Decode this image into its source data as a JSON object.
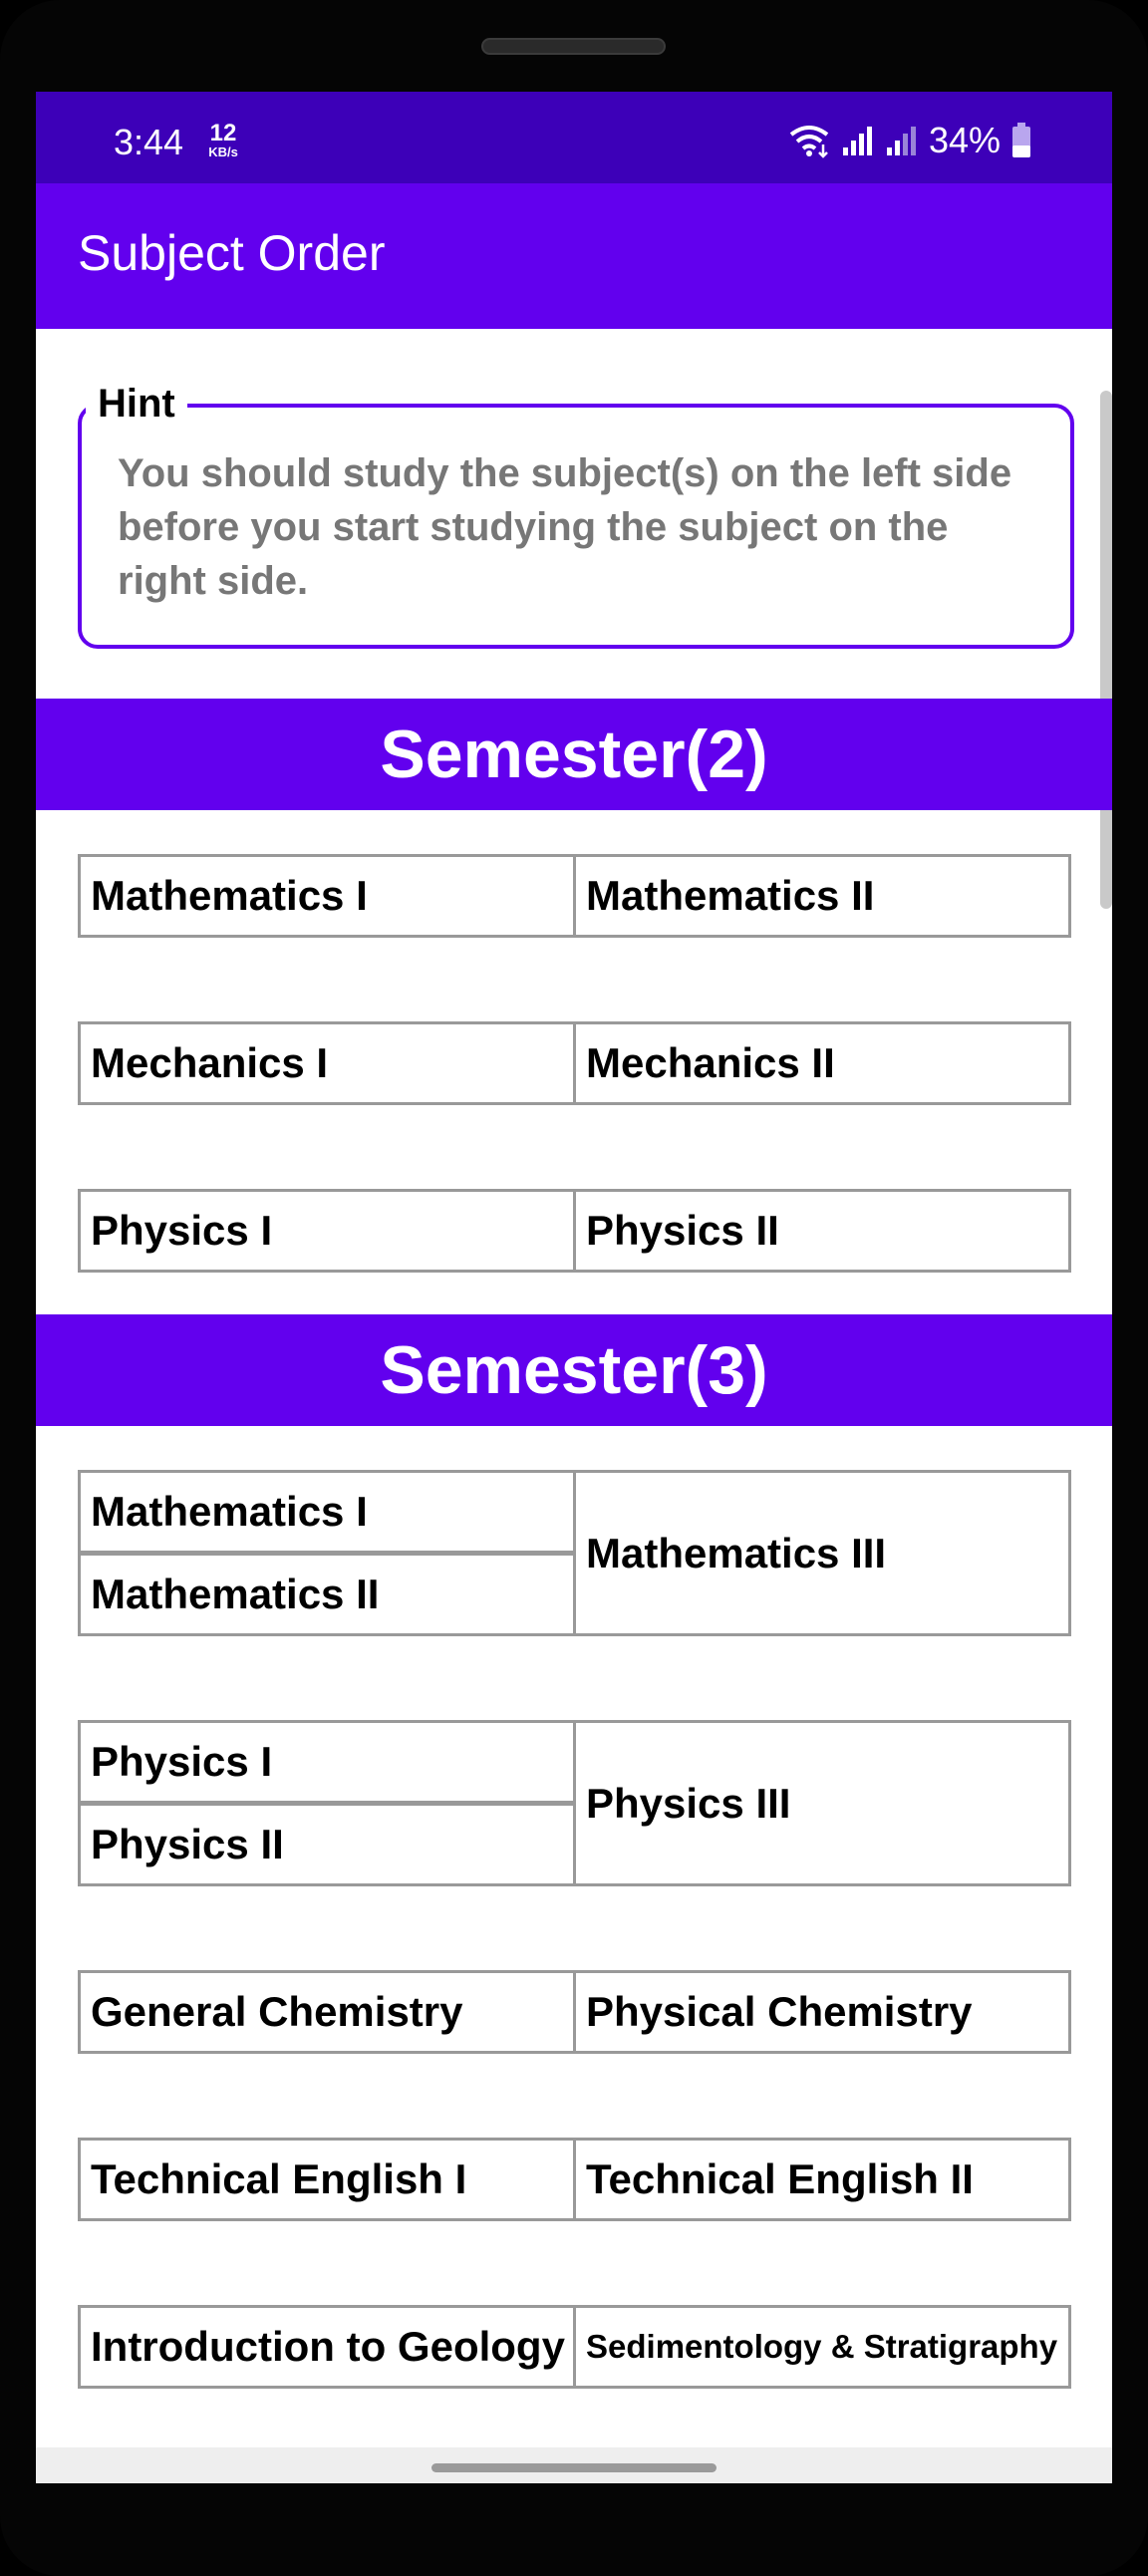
{
  "status_bar": {
    "time": "3:44",
    "net_speed_value": "12",
    "net_speed_unit": "KB/s",
    "battery_percent": "34%",
    "icons": [
      "wifi-icon",
      "signal-icon",
      "signal-icon-2",
      "battery-icon"
    ]
  },
  "app_bar": {
    "title": "Subject Order"
  },
  "hint": {
    "label": "Hint",
    "text": "You should study the subject(s) on the left side before you start studying the subject on the right side."
  },
  "semesters": [
    {
      "title": "Semester(2)",
      "rows": [
        {
          "prereq": [
            "Mathematics I"
          ],
          "subject": "Mathematics II"
        },
        {
          "prereq": [
            "Mechanics I"
          ],
          "subject": "Mechanics II"
        },
        {
          "prereq": [
            "Physics I"
          ],
          "subject": "Physics II"
        }
      ]
    },
    {
      "title": "Semester(3)",
      "rows": [
        {
          "prereq": [
            "Mathematics I",
            "Mathematics II"
          ],
          "subject": "Mathematics III"
        },
        {
          "prereq": [
            "Physics I",
            "Physics II"
          ],
          "subject": "Physics III"
        },
        {
          "prereq": [
            "General Chemistry"
          ],
          "subject": "Physical Chemistry"
        },
        {
          "prereq": [
            "Technical English I"
          ],
          "subject": "Technical English II"
        },
        {
          "prereq": [
            "Introduction to Geology"
          ],
          "subject": "Sedimentology & Stratigraphy"
        }
      ]
    }
  ],
  "colors": {
    "status_bar": "#3d00b8",
    "primary": "#6200ee",
    "hint_text": "#777777",
    "cell_border": "#999999"
  }
}
